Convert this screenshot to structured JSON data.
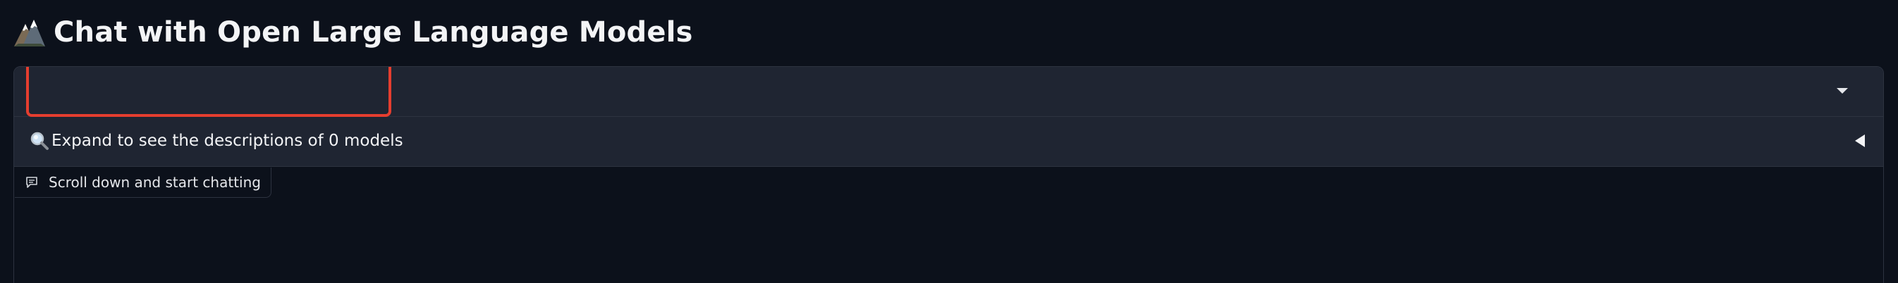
{
  "header": {
    "title": "Chat with Open Large Language Models",
    "logo_icon": "mountain-logo-icon"
  },
  "model_selector": {
    "value": "",
    "icon": "chevron-down-icon"
  },
  "descriptions_accordion": {
    "icon": "magnifying-glass-icon",
    "label": "Expand to see the descriptions of 0 models",
    "toggle_icon": "triangle-left-icon"
  },
  "chat": {
    "hint_icon": "chat-bubble-icon",
    "hint_label": "Scroll down and start chatting"
  },
  "colors": {
    "background": "#0c111b",
    "panel": "#1f2532",
    "border": "#2d3340",
    "highlight": "#e53e2f",
    "text": "#f3f4f6"
  }
}
